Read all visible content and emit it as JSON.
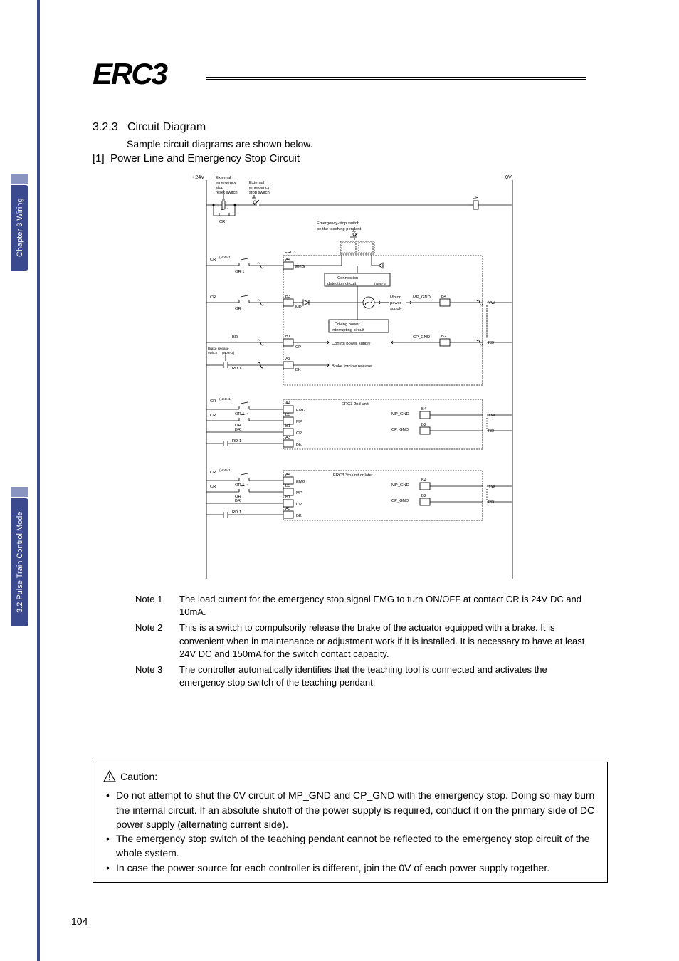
{
  "sidebar": {
    "top_label": "Chapter 3 Wiring",
    "bottom_label": "3.2 Pulse Train Control Mode"
  },
  "logo": "ERC3",
  "section": {
    "number": "3.2.3",
    "title": "Circuit Diagram",
    "intro": "Sample circuit diagrams are shown below.",
    "sub_number": "[1]",
    "sub_title": "Power Line and Emergency Stop Circuit"
  },
  "diagram": {
    "v24": "+24V",
    "v0": "0V",
    "ext_reset": [
      "External",
      "emergency",
      "stop",
      "reset switch"
    ],
    "ext_stop": [
      "External",
      "emergency",
      "stop switch"
    ],
    "cr": "CR",
    "teaching_pendant": [
      "Emergency-stop switch",
      "on the teaching pendant"
    ],
    "erc3": "ERC3",
    "note1_ref": "(Note 1)",
    "note2_ref": "(Note 2)",
    "note3_ref": "(Note 3)",
    "or1": "OR 1",
    "or": "OR",
    "br": "BR",
    "rd1": "RD 1",
    "brake_sw": [
      "Brake release",
      "switch"
    ],
    "pins": {
      "a4": "A4",
      "b3": "B3",
      "b1": "B1",
      "a3": "A3",
      "b4": "B4",
      "b2": "B2"
    },
    "sig": {
      "emg": "EMG",
      "mp": "MP",
      "cp": "CP",
      "bk": "BK",
      "mp_gnd": "MP_GND",
      "cp_gnd": "CP_GND"
    },
    "conn_detect": [
      "Connection",
      "detection circuit"
    ],
    "motor_ps": [
      "Motor",
      "power",
      "supply"
    ],
    "driving_pw": [
      "Driving power",
      "interrupting circuit"
    ],
    "control_ps": "Control power supply",
    "brake_release": "Brake forcible release",
    "unit2": "ERC3   2nd unit",
    "unit3": "ERC3   3th unit or later",
    "yw": "YW",
    "rd": "RD"
  },
  "notes": [
    {
      "label": "Note 1",
      "text": "The load current for the emergency stop signal EMG to turn ON/OFF at contact CR is 24V DC and 10mA."
    },
    {
      "label": "Note 2",
      "text": "This is a switch to compulsorily release the brake of the actuator equipped with a brake. It is convenient when in maintenance or adjustment work if it is installed. It is necessary to have at least 24V DC and 150mA for the switch contact capacity."
    },
    {
      "label": "Note 3",
      "text": "The controller automatically identifies that the teaching tool is connected and activates the emergency stop switch of the teaching pendant."
    }
  ],
  "caution": {
    "title": "Caution:",
    "items": [
      "Do not attempt to shut the 0V circuit of MP_GND and CP_GND with the emergency stop. Doing so may burn the internal circuit. If an absolute shutoff of the power supply is required, conduct it on the primary side of DC power supply (alternating current side).",
      "The emergency stop switch of the teaching pendant cannot be reflected to the emergency stop circuit of the whole system.",
      "In case the power source for each controller is different, join the 0V of each power supply together."
    ]
  },
  "page": "104"
}
